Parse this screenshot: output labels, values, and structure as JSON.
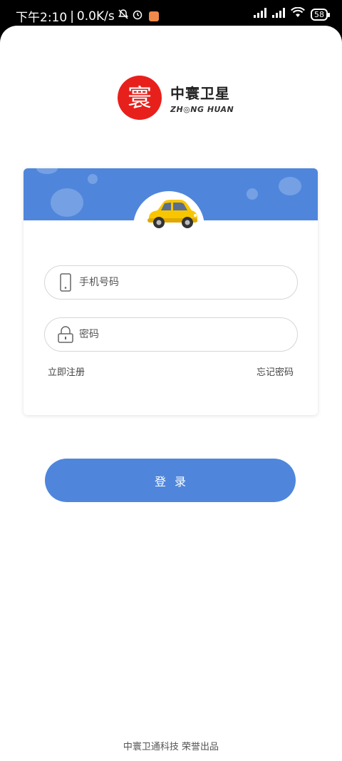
{
  "status_bar": {
    "time": "下午2:10",
    "separator": "|",
    "net_speed": "0.0K/s",
    "battery": "58"
  },
  "brand": {
    "logo_char": "寰",
    "name_cn": "中寰卫星",
    "name_en": "ZH◎NG HUAN"
  },
  "form": {
    "phone_placeholder": "手机号码",
    "password_placeholder": "密码",
    "register_link": "立即注册",
    "forgot_link": "忘记密码"
  },
  "login_button": "登录",
  "footer": "中寰卫通科技 荣誉出品",
  "colors": {
    "accent": "#4f86dc",
    "logo_red": "#e8201c",
    "car_yellow": "#f7c600"
  }
}
